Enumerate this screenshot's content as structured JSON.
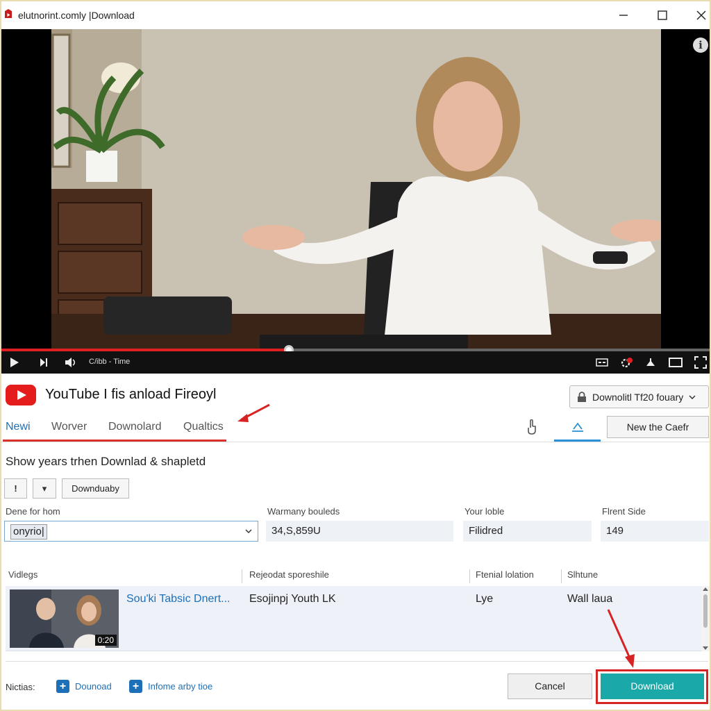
{
  "window": {
    "title": "elutnorint.comly |Download",
    "controls": [
      "minimize-icon",
      "maximize-icon",
      "close-icon"
    ]
  },
  "player": {
    "time": "C/ibb - Time",
    "progress": 0.406,
    "info_icon": "i",
    "controls_right": [
      "subtitles-icon",
      "settings-icon",
      "airplay-icon",
      "theater-icon",
      "fullscreen-icon"
    ],
    "notification_badge": "•"
  },
  "brand": {
    "title": "YouTube I fis anload Fireoyl",
    "quality_button": "Downolitl Tf20 fouary"
  },
  "tabs": [
    {
      "label": "Newi",
      "active": true
    },
    {
      "label": "Worver",
      "active": false
    },
    {
      "label": "Downolard",
      "active": false
    },
    {
      "label": "Qualtics",
      "active": false
    }
  ],
  "toolbar": {
    "new_button": "New the Caefr"
  },
  "section": {
    "heading": "Show years trhen Downlad & shapletd",
    "btn_exclaim": "!",
    "btn_dropdown": "▾",
    "btn_text": "Downduaby"
  },
  "fields": [
    {
      "label": "Dene for hom",
      "value": "onyrio|"
    },
    {
      "label": "Warmany bouleds",
      "value": "34,S,859U"
    },
    {
      "label": "Your loble",
      "value": "Filidred"
    },
    {
      "label": "Flrent Side",
      "value": "149"
    }
  ],
  "table": {
    "headers": [
      "Vidlegs",
      "Rejeodat sporeshile",
      "Ftenial lolation",
      "Slhtune"
    ],
    "rows": [
      {
        "title": "Sou'ki Tabsic Dnert...",
        "description": "Esojinpj Youth LK",
        "location": "Lye",
        "status": "Wall laua",
        "duration": "0:20"
      }
    ]
  },
  "footer": {
    "label": "Nictias:",
    "link1": "Dounoad",
    "link2": "Infome arby tioe",
    "cancel": "Cancel",
    "download": "Download"
  },
  "colors": {
    "accent_red": "#d9322b",
    "teal": "#1aa8a8",
    "link_blue": "#1d6fb8",
    "youtube_red": "#e51c1c"
  }
}
